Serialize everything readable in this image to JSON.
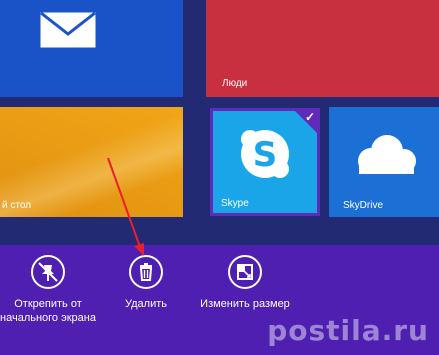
{
  "tiles": {
    "mail": {
      "label": ""
    },
    "people": {
      "label": "Люди"
    },
    "desktop": {
      "label": "й стол"
    },
    "skype": {
      "label": "Skype",
      "selected": true
    },
    "skydrive": {
      "label": "SkyDrive"
    }
  },
  "app_bar": {
    "unpin": {
      "label": "Открепить от начального экрана",
      "icon": "unpin-icon"
    },
    "delete": {
      "label": "Удалить",
      "icon": "trash-icon"
    },
    "resize": {
      "label": "Изменить размер",
      "icon": "resize-icon"
    }
  },
  "watermark": "postila.ru",
  "colors": {
    "app_bar": "#4f1fb2",
    "mail": "#1a53c8",
    "people": "#c8303f",
    "desktop": "#f0a617",
    "skype": "#1aa5e8",
    "skydrive": "#1c6fd4",
    "annotation_arrow": "#e8202a"
  }
}
